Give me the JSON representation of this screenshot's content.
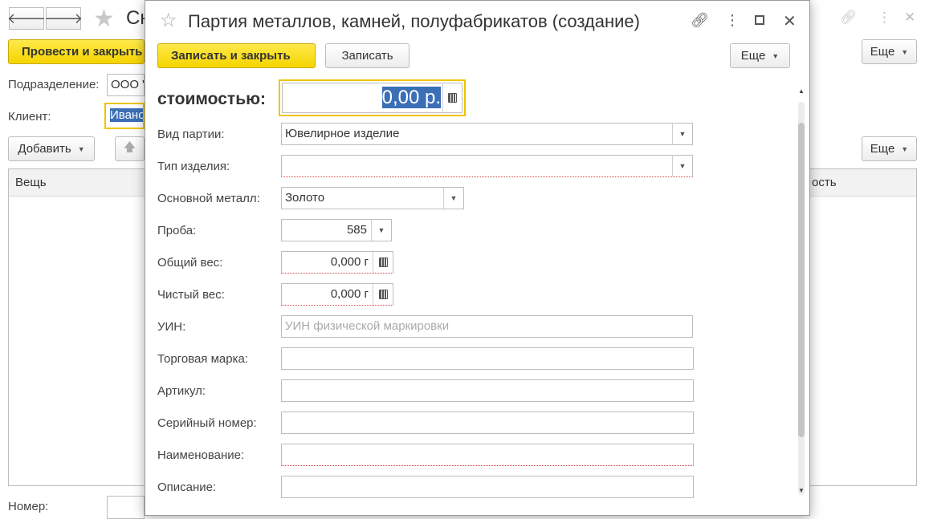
{
  "background": {
    "title": "Сн",
    "post_close_label": "Провести и закрыть",
    "more_top_label": "Еще",
    "division_label": "Подразделение:",
    "division_value": "ООО \"",
    "client_label": "Клиент:",
    "client_value": "Иванов",
    "add_label": "Добавить",
    "more_table_label": "Еще",
    "col_item": "Вещь",
    "col_cost": "ость",
    "number_label": "Номер:"
  },
  "modal": {
    "title": "Партия металлов, камней, полуфабрикатов (создание)",
    "save_close_label": "Записать и закрыть",
    "save_label": "Записать",
    "more_label": "Еще",
    "cost_label": "стоимостью:",
    "cost_value": "0,00 р.",
    "fields": {
      "batch_type": {
        "label": "Вид партии:",
        "value": "Ювелирное изделие"
      },
      "item_type": {
        "label": "Тип изделия:",
        "value": ""
      },
      "metal": {
        "label": "Основной металл:",
        "value": "Золото"
      },
      "probe": {
        "label": "Проба:",
        "value": "585"
      },
      "total_weight": {
        "label": "Общий вес:",
        "value": "0,000 г"
      },
      "net_weight": {
        "label": "Чистый вес:",
        "value": "0,000 г"
      },
      "uin": {
        "label": "УИН:",
        "value": "",
        "placeholder": "УИН физической маркировки"
      },
      "brand": {
        "label": "Торговая марка:",
        "value": ""
      },
      "article": {
        "label": "Артикул:",
        "value": ""
      },
      "serial": {
        "label": "Серийный номер:",
        "value": ""
      },
      "name": {
        "label": "Наименование:",
        "value": ""
      },
      "description": {
        "label": "Описание:",
        "value": ""
      }
    }
  },
  "icons": {
    "back": "arrow-left-icon",
    "forward": "arrow-right-icon",
    "favorite": "star-icon",
    "link": "link-icon",
    "menu": "more-vertical-icon",
    "maximize": "maximize-icon",
    "close": "close-icon",
    "calculator": "calculator-icon",
    "dropdown": "chevron-down-icon",
    "move_up": "arrow-up-icon"
  },
  "colors": {
    "accent_yellow": "#f5d400",
    "focus_border": "#f0c400",
    "selection": "#3b6fb6"
  }
}
